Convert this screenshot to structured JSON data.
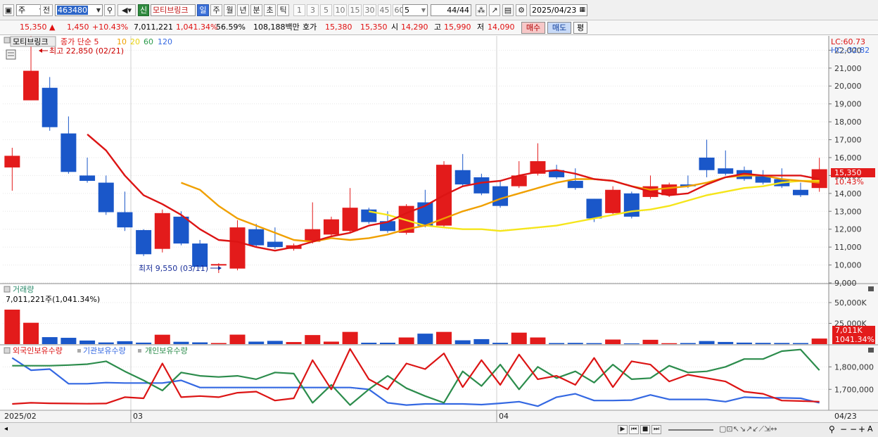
{
  "toolbar": {
    "market": "주",
    "code_prefix": "전",
    "code": "463480",
    "badge": "신",
    "stock_name": "모티브링크",
    "period_tabs": [
      "일",
      "주",
      "월",
      "년",
      "분",
      "초",
      "틱"
    ],
    "active_period": "일",
    "intervals": [
      "1",
      "3",
      "5",
      "10",
      "15",
      "30",
      "45",
      "60"
    ],
    "interval_select": "5",
    "count": "44",
    "count_total": "/44",
    "date": "2025/04/23"
  },
  "info": {
    "price": "15,350",
    "change": "1,450",
    "change_pct": "+10.43%",
    "volume": "7,011,221",
    "volume_ratio": "1,041.34%",
    "turnover": "56.59%",
    "amount": "108,188백만",
    "ask_label": "호가",
    "ask": "15,380",
    "bid": "15,350",
    "open_label": "시",
    "open": "14,290",
    "high_label": "고",
    "high": "15,990",
    "low_label": "저",
    "low": "14,090",
    "buy_button": "매수",
    "sell_button": "매도",
    "eval_button": "평"
  },
  "colors": {
    "up": "#e31b1b",
    "down": "#1a57c9",
    "ma5": "#dc1414",
    "ma10": "#f0a000",
    "ma20": "#f5e51a",
    "foreign": "#dc1414",
    "institution": "#3468e2",
    "individual": "#2c8c4c"
  },
  "chart_data": [
    {
      "type": "candlestick",
      "legend_name": "모티브링크",
      "legend_ma": [
        "종가 단순 5",
        "10",
        "20",
        "60",
        "120"
      ],
      "ylim": [
        9000,
        22800
      ],
      "yticks": [
        9000,
        10000,
        11000,
        12000,
        13000,
        14000,
        15000,
        16000,
        17000,
        18000,
        19000,
        20000,
        21000,
        22000
      ],
      "ytick_labels": [
        "9,000",
        "10,000",
        "11,000",
        "12,000",
        "13,000",
        "14,000",
        "15,000",
        "16,000",
        "17,000",
        "18,000",
        "19,000",
        "20,000",
        "21,000",
        "22,000"
      ],
      "x_labels": [
        "2025/02",
        "03",
        "04",
        "04/23"
      ],
      "top_right": [
        "LC:60.73",
        "HC:-32.82"
      ],
      "current_price_tag": "15,350",
      "current_change_tag": "10.43%",
      "annotation_high": "최고 22,850 (02/21)",
      "annotation_low": "최저 9,550 (03/11)",
      "candles": [
        [
          15450,
          16100,
          14150,
          16550
        ],
        [
          19200,
          20850,
          19200,
          22850
        ],
        [
          19900,
          17700,
          17500,
          20500
        ],
        [
          17350,
          15200,
          15100,
          18300
        ],
        [
          15000,
          14700,
          14600,
          16000
        ],
        [
          14600,
          12950,
          12800,
          15000
        ],
        [
          12950,
          12100,
          11900,
          14100
        ],
        [
          11950,
          10600,
          10500,
          12000
        ],
        [
          10900,
          12900,
          10700,
          13100
        ],
        [
          12700,
          11200,
          11100,
          13000
        ],
        [
          11200,
          9900,
          9800,
          11400
        ],
        [
          10000,
          10050,
          9550,
          10100
        ],
        [
          9800,
          12100,
          9700,
          12500
        ],
        [
          12000,
          11100,
          11000,
          12300
        ],
        [
          11300,
          11000,
          10900,
          12100
        ],
        [
          10900,
          11100,
          10800,
          11200
        ],
        [
          11300,
          12000,
          11200,
          13500
        ],
        [
          11700,
          12550,
          11600,
          12700
        ],
        [
          11900,
          13200,
          11800,
          14300
        ],
        [
          13100,
          12400,
          12300,
          13200
        ],
        [
          12450,
          11900,
          11800,
          13000
        ],
        [
          11800,
          13300,
          11700,
          13400
        ],
        [
          13500,
          12200,
          12100,
          14200
        ],
        [
          12200,
          15600,
          12100,
          15800
        ],
        [
          15300,
          14500,
          14400,
          16200
        ],
        [
          14900,
          14000,
          13900,
          15100
        ],
        [
          14400,
          13300,
          13200,
          14700
        ],
        [
          14400,
          15000,
          14300,
          15800
        ],
        [
          15100,
          15800,
          15000,
          16800
        ],
        [
          15300,
          14900,
          14800,
          15600
        ],
        [
          14700,
          14300,
          14200,
          15400
        ],
        [
          13700,
          12600,
          12400,
          13700
        ],
        [
          12900,
          14200,
          12800,
          14400
        ],
        [
          14000,
          12700,
          12600,
          14100
        ],
        [
          13800,
          14400,
          13700,
          15000
        ],
        [
          13900,
          14500,
          13800,
          14600
        ],
        [
          14500,
          14400,
          14300,
          15000
        ],
        [
          16000,
          15300,
          14900,
          17000
        ],
        [
          15400,
          15100,
          15000,
          16400
        ],
        [
          15300,
          14800,
          14700,
          15500
        ],
        [
          15000,
          14600,
          14500,
          15300
        ],
        [
          14800,
          14400,
          14300,
          15400
        ],
        [
          14200,
          13900,
          13800,
          14600
        ],
        [
          14300,
          15350,
          14090,
          15990
        ]
      ],
      "ma5": [
        null,
        null,
        null,
        null,
        17300,
        16400,
        15000,
        13900,
        13400,
        12800,
        12000,
        11400,
        11300,
        11000,
        10800,
        11000,
        11300,
        11600,
        11800,
        12200,
        12400,
        12900,
        13300,
        13900,
        14400,
        14600,
        14700,
        15000,
        15200,
        15300,
        15100,
        14800,
        14700,
        14400,
        14100,
        13900,
        14000,
        14500,
        14900,
        15100,
        15000,
        15000,
        15000,
        14800
      ],
      "ma10": [
        null,
        null,
        null,
        null,
        null,
        null,
        null,
        null,
        null,
        14600,
        14200,
        13300,
        12600,
        12200,
        11800,
        11400,
        11300,
        11500,
        11400,
        11500,
        11700,
        12000,
        12200,
        12600,
        13000,
        13300,
        13700,
        14000,
        14300,
        14600,
        14800,
        14800,
        14700,
        14400,
        14200,
        14300,
        14400,
        14600,
        14900,
        15000,
        15000,
        14800,
        14700,
        14600
      ],
      "ma20": [
        null,
        null,
        null,
        null,
        null,
        null,
        null,
        null,
        null,
        null,
        null,
        null,
        null,
        null,
        null,
        null,
        null,
        null,
        null,
        13000,
        12800,
        12500,
        12200,
        12100,
        12000,
        12000,
        11900,
        12000,
        12100,
        12200,
        12400,
        12600,
        12800,
        13000,
        13100,
        13300,
        13600,
        13900,
        14100,
        14300,
        14400,
        14600,
        14700,
        14700
      ],
      "volume_pane": {
        "title": "거래량",
        "readout": "7,011,221주(1,041.34%)",
        "ylim": [
          0,
          72000
        ],
        "ytick_labels": [
          "50,000K",
          "25,000K"
        ],
        "yticks": [
          50000,
          25000
        ],
        "current_tag": "7,011K",
        "current_pct_tag": "1041.34%",
        "values": [
          41500,
          25700,
          8400,
          7600,
          4300,
          2000,
          3500,
          1800,
          11300,
          2800,
          2100,
          1300,
          11400,
          3000,
          3900,
          2500,
          10900,
          3000,
          14700,
          1700,
          1700,
          8000,
          12600,
          14700,
          4600,
          6000,
          1600,
          13800,
          8000,
          1300,
          1500,
          1200,
          5500,
          900,
          5200,
          1100,
          1300,
          3700,
          2600,
          1800,
          1500,
          1400,
          1300,
          6700
        ]
      },
      "holdings_pane": {
        "series_names": [
          "외국인보유수량",
          "기관보유수량",
          "개인보유수량"
        ],
        "ylim": [
          1610000,
          1895000
        ],
        "yticks": [
          1800000,
          1700000
        ],
        "ytick_labels": [
          "1,800,000",
          "1,700,000"
        ],
        "foreign": [
          1635000,
          1640000,
          1638000,
          1637000,
          1636000,
          1637000,
          1665000,
          1660000,
          1815000,
          1665000,
          1670000,
          1665000,
          1685000,
          1690000,
          1650000,
          1660000,
          1830000,
          1700000,
          1880000,
          1745000,
          1700000,
          1815000,
          1790000,
          1860000,
          1710000,
          1830000,
          1720000,
          1855000,
          1745000,
          1760000,
          1720000,
          1840000,
          1710000,
          1825000,
          1810000,
          1735000,
          1765000,
          1750000,
          1735000,
          1690000,
          1680000,
          1650000,
          1648000,
          1645000
        ],
        "institution": [
          1840000,
          1785000,
          1790000,
          1725000,
          1725000,
          1730000,
          1728000,
          1728000,
          1728000,
          1740000,
          1708000,
          1708000,
          1708000,
          1708000,
          1708000,
          1708000,
          1708000,
          1708000,
          1708000,
          1700000,
          1640000,
          1630000,
          1635000,
          1635000,
          1635000,
          1632000,
          1638000,
          1645000,
          1625000,
          1665000,
          1680000,
          1650000,
          1650000,
          1652000,
          1675000,
          1655000,
          1655000,
          1655000,
          1645000,
          1665000,
          1662000,
          1662000,
          1660000,
          1640000
        ],
        "individual": [
          1805000,
          1805000,
          1805000,
          1808000,
          1812000,
          1825000,
          1780000,
          1740000,
          1695000,
          1775000,
          1760000,
          1755000,
          1760000,
          1745000,
          1775000,
          1770000,
          1640000,
          1720000,
          1630000,
          1700000,
          1760000,
          1705000,
          1670000,
          1640000,
          1780000,
          1715000,
          1810000,
          1700000,
          1800000,
          1750000,
          1780000,
          1730000,
          1810000,
          1745000,
          1750000,
          1805000,
          1775000,
          1780000,
          1800000,
          1835000,
          1835000,
          1870000,
          1877000,
          1785000
        ]
      }
    }
  ],
  "scroll_tools": [
    "▶",
    "⏮",
    "■",
    "⏭"
  ]
}
